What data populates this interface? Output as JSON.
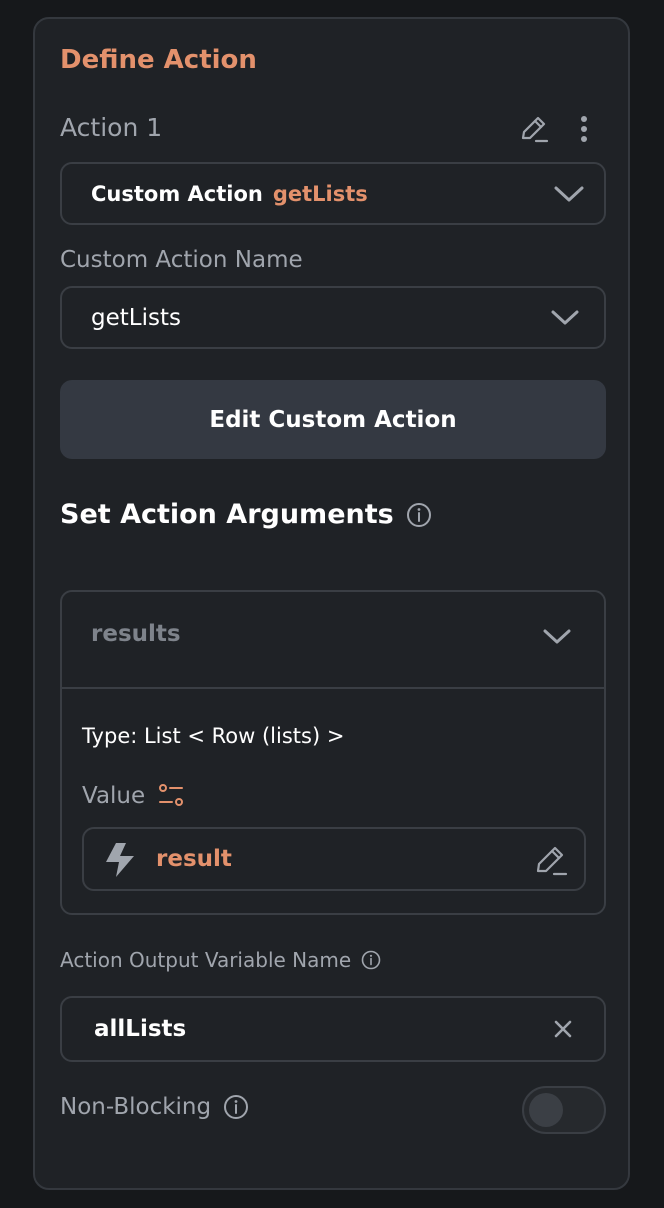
{
  "panel": {
    "title": "Define Action",
    "action_label": "Action 1"
  },
  "action_select": {
    "type_label": "Custom Action",
    "name": "getLists"
  },
  "custom_action_name": {
    "label": "Custom Action Name",
    "value": "getLists"
  },
  "edit_button": {
    "label": "Edit Custom Action"
  },
  "arguments": {
    "title": "Set Action Arguments",
    "argument": {
      "name": "results",
      "type_text": "Type: List < Row (lists) >",
      "value_label": "Value",
      "value": "result"
    }
  },
  "output": {
    "label": "Action Output Variable Name",
    "value": "allLists"
  },
  "non_blocking": {
    "label": "Non-Blocking",
    "enabled": false
  },
  "colors": {
    "accent": "#e3916c",
    "background": "#16181b",
    "panel": "#1f2226",
    "border": "#3a3e44",
    "button": "#343942"
  }
}
